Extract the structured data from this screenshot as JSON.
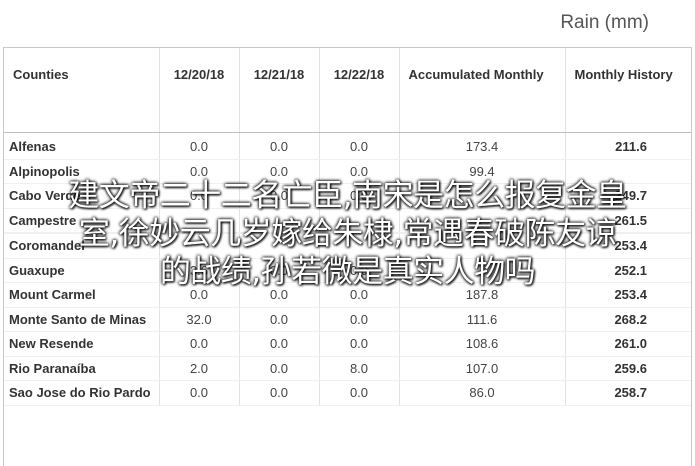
{
  "header": {
    "title": "Rain (mm)"
  },
  "table": {
    "columns": [
      "Counties",
      "12/20/18",
      "12/21/18",
      "12/22/18",
      "Accumulated Monthly",
      "Monthly History"
    ],
    "rows": [
      {
        "name": "Alfenas",
        "d1": "0.0",
        "d2": "0.0",
        "d3": "0.0",
        "acc": "173.4",
        "hist": "211.6"
      },
      {
        "name": "Alpinopolis",
        "d1": "0.0",
        "d2": "0.0",
        "d3": "0.0",
        "acc": "99.4",
        "hist": ""
      },
      {
        "name": "Cabo Verde",
        "d1": "0.0",
        "d2": "0.0",
        "d3": "0.0",
        "acc": "",
        "hist": "249.7"
      },
      {
        "name": "Campestre",
        "d1": "",
        "d2": "",
        "d3": "",
        "acc": "",
        "hist": "261.5"
      },
      {
        "name": "",
        "d1": "",
        "d2": "",
        "d3": "",
        "acc": "",
        "hist": ""
      },
      {
        "name": "Coromandel",
        "d1": "",
        "d2": "",
        "d3": "",
        "acc": "",
        "hist": "253.4"
      },
      {
        "name": "Guaxupe",
        "d1": "3.6",
        "d2": "0.0",
        "d3": "0.0",
        "acc": "",
        "hist": "252.1"
      },
      {
        "name": "Mount Carmel",
        "d1": "0.0",
        "d2": "0.0",
        "d3": "0.0",
        "acc": "187.8",
        "hist": "253.4"
      },
      {
        "name": "Monte Santo de Minas",
        "d1": "32.0",
        "d2": "0.0",
        "d3": "0.0",
        "acc": "111.6",
        "hist": "268.2"
      },
      {
        "name": "New Resende",
        "d1": "0.0",
        "d2": "0.0",
        "d3": "0.0",
        "acc": "108.6",
        "hist": "261.0"
      },
      {
        "name": "Rio Paranaíba",
        "d1": "2.0",
        "d2": "0.0",
        "d3": "8.0",
        "acc": "107.0",
        "hist": "259.6"
      },
      {
        "name": "Sao Jose do Rio Pardo",
        "d1": "0.0",
        "d2": "0.0",
        "d3": "0.0",
        "acc": "86.0",
        "hist": "258.7"
      }
    ]
  },
  "overlay": {
    "lines": [
      "建文帝二十二名亡臣,南宋是怎么报复金皇",
      "室,徐妙云几岁嫁给朱棣,常遇春破陈友谅",
      "的战绩,孙若微是真实人物吗"
    ]
  }
}
